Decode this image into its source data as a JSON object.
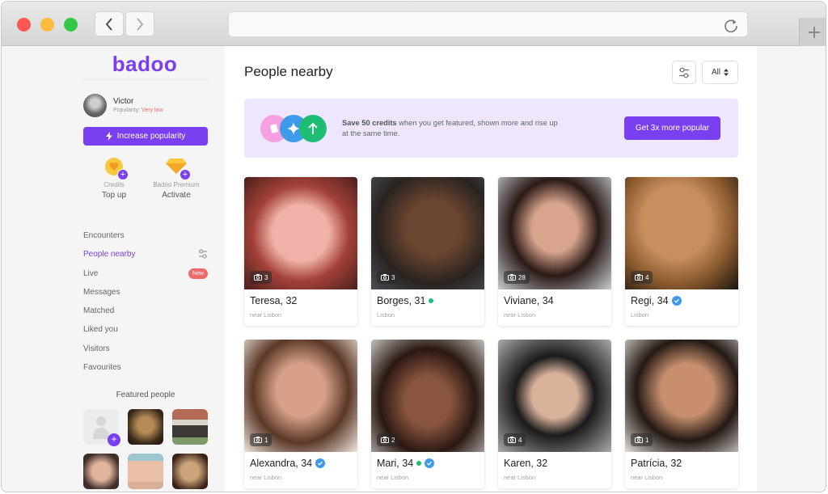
{
  "browser": {
    "back_label": "Back",
    "forward_label": "Forward",
    "address_value": "",
    "new_tab_label": "+"
  },
  "sidebar": {
    "logo": "badoo",
    "user": {
      "name": "Victor",
      "popularity_label": "Popularity:",
      "popularity_value": "Very low"
    },
    "increase_button": "Increase popularity",
    "perks": [
      {
        "label": "Credits",
        "action": "Top up",
        "icon": "coin-heart-icon"
      },
      {
        "label": "Badoo Premium",
        "action": "Activate",
        "icon": "diamond-icon"
      }
    ],
    "nav": [
      {
        "label": "Encounters",
        "active": false
      },
      {
        "label": "People nearby",
        "active": true
      },
      {
        "label": "Live",
        "active": false,
        "badge": "New"
      },
      {
        "label": "Messages",
        "active": false
      },
      {
        "label": "Matched",
        "active": false
      },
      {
        "label": "Liked you",
        "active": false
      },
      {
        "label": "Visitors",
        "active": false
      },
      {
        "label": "Favourites",
        "active": false
      }
    ],
    "featured_title": "Featured people",
    "featured_add_label": "+"
  },
  "main": {
    "title": "People nearby",
    "filter_select": "All",
    "promo": {
      "bold": "Save 50 credits",
      "text": " when you get featured, shown more and rise up at the same time.",
      "button": "Get 3x more popular"
    },
    "people": [
      {
        "name": "Teresa, 32",
        "location": "near Lisbon",
        "photos": "3",
        "online": false,
        "verified": false
      },
      {
        "name": "Borges, 31",
        "location": "Lisbon",
        "photos": "3",
        "online": true,
        "verified": false
      },
      {
        "name": "Viviane, 34",
        "location": "near Lisbon",
        "photos": "28",
        "online": false,
        "verified": false
      },
      {
        "name": "Regi, 34",
        "location": "Lisbon",
        "photos": "4",
        "online": false,
        "verified": true
      },
      {
        "name": "Alexandra, 34",
        "location": "near Lisbon",
        "photos": "1",
        "online": false,
        "verified": true
      },
      {
        "name": "Mari, 34",
        "location": "near Lisbon",
        "photos": "2",
        "online": true,
        "verified": true
      },
      {
        "name": "Karen, 32",
        "location": "near Lisbon",
        "photos": "4",
        "online": false,
        "verified": false
      },
      {
        "name": "Patrícia, 32",
        "location": "near Lisbon",
        "photos": "1",
        "online": false,
        "verified": false
      }
    ]
  },
  "colors": {
    "brand": "#7a3ff1",
    "online": "#1dbd73",
    "verified": "#3d9be9",
    "alert": "#f06a6a",
    "promo_bg": "#ede6fd"
  }
}
